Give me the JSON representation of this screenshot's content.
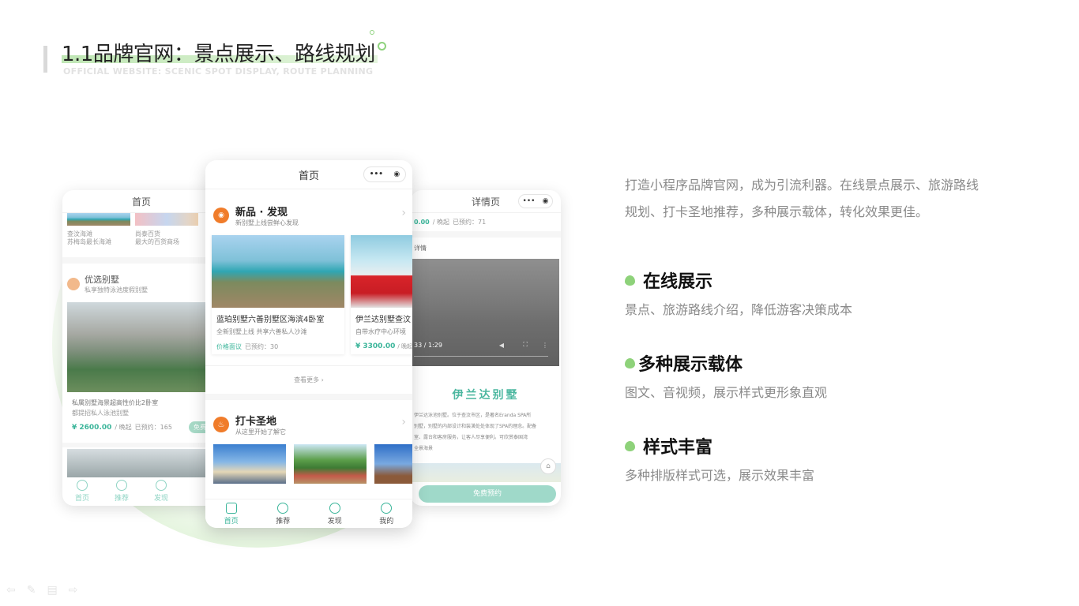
{
  "title": {
    "main": "1.1品牌官网：景点展示、路线规划",
    "subtitle": "OFFICIAL WEBSITE: SCENIC SPOT DISPLAY, ROUTE PLANNING"
  },
  "phone_left": {
    "header": "首页",
    "top_cards": [
      {
        "line1": "查汶海滩",
        "line2": "苏梅岛最长海滩"
      },
      {
        "line1": "尚泰百货",
        "line2": "最大的百货商场"
      }
    ],
    "section_title": "优选别墅",
    "section_sub": "私享独特泳池度假别墅",
    "villa_name": "私属别墅海景超高性价比2卧室",
    "villa_desc": "都提招私人泳池别墅",
    "villa_price": "¥ 2600.00",
    "villa_unit": "/ 晚起",
    "villa_booked": "已预约：165",
    "villa_btn": "免费",
    "tabs": [
      "首页",
      "推荐",
      "发现"
    ]
  },
  "phone_center": {
    "header": "首页",
    "capsule_more": "•••",
    "capsule_close": "◉",
    "section1_title": "新品 · 发现",
    "section1_sub": "新别墅上线尝鲜心发现",
    "card1": {
      "name": "蓝珀别墅六善别墅区海滨4卧室",
      "desc": "全新别墅上线 共享六善私人沙滩",
      "price": "价格面议",
      "booked": "已预约：30"
    },
    "card2": {
      "name": "伊兰达别墅查汶",
      "desc": "自带水疗中心环境",
      "price": "¥ 3300.00",
      "unit": "/ 晚起"
    },
    "see_more": "查看更多 ›",
    "section2_title": "打卡圣地",
    "section2_sub": "从这里开始了解它",
    "tabs": [
      "首页",
      "推荐",
      "发现",
      "我的"
    ]
  },
  "phone_right": {
    "header": "详情页",
    "price_line": "0.00",
    "price_unit": "/ 晚起",
    "booked": "已预约：71",
    "section_label": "详情",
    "video_time": "33 / 1:29",
    "brand_title": "伊兰达别墅",
    "desc_lines": [
      "伊兰达泳池别墅。位于查汶市区，是著名Eranda SPA所",
      "别墅，别墅的内部设计和装潢处处体现了SPA的理念。配备",
      "室、露台和客房服务，让客人尽享便利。可欣赏泰国湾",
      "全景海景"
    ],
    "book_btn": "免费预约"
  },
  "intro": "打造小程序品牌官网，成为引流利器。在线景点展示、旅游路线规划、打卡圣地推荐，多种展示载体，转化效果更佳。",
  "features": [
    {
      "title": "在线展示",
      "desc": "景点、旅游路线介绍，降低游客决策成本"
    },
    {
      "title": "多种展示载体",
      "desc": "图文、音视频，展示样式更形象直观"
    },
    {
      "title": "样式丰富",
      "desc": "多种排版样式可选，展示效果丰富"
    }
  ],
  "toolbar_icons": [
    "prev-arrow-icon",
    "pen-icon",
    "menu-icon",
    "next-arrow-icon"
  ],
  "colors": {
    "accent_green": "#8ed27a",
    "teal": "#3bb59a",
    "orange": "#f07c2a"
  }
}
